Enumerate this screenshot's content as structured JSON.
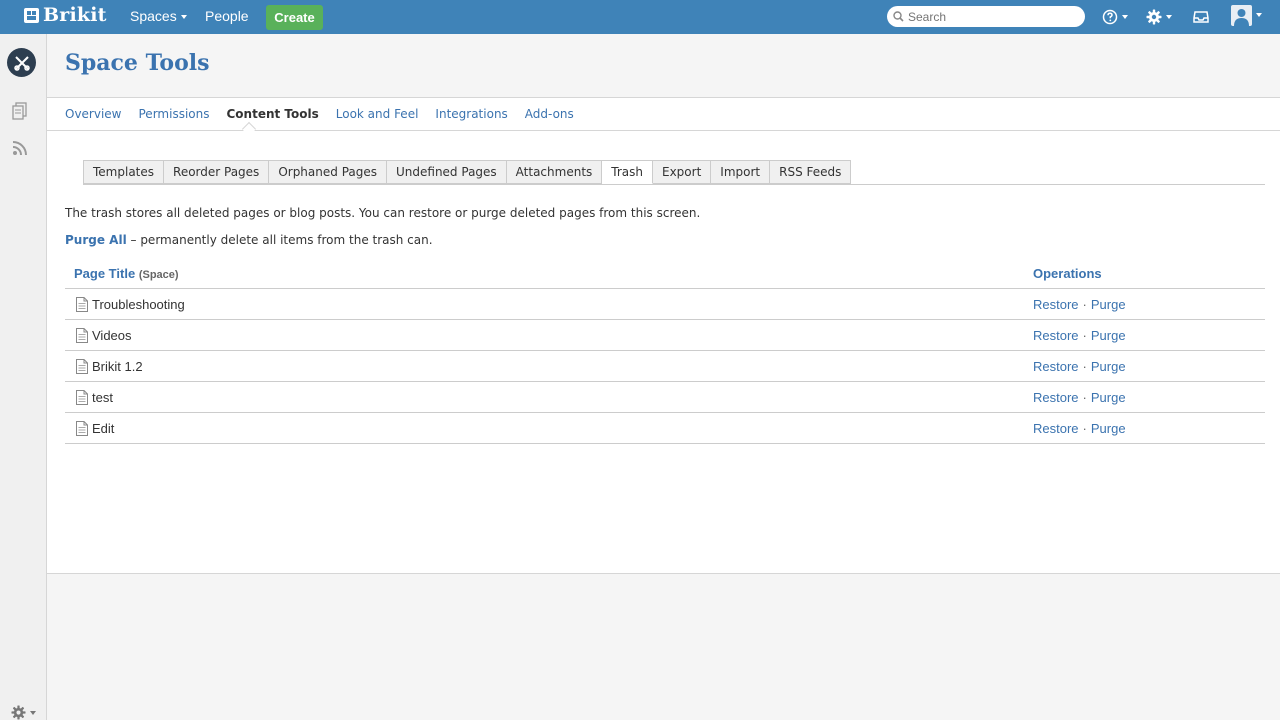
{
  "app": {
    "logo_text": "Brikit",
    "nav": {
      "spaces_label": "Spaces",
      "people_label": "People",
      "create_label": "Create"
    },
    "search": {
      "placeholder": "Search"
    }
  },
  "header": {
    "title": "Space Tools"
  },
  "tabs": [
    {
      "label": "Overview"
    },
    {
      "label": "Permissions"
    },
    {
      "label": "Content Tools"
    },
    {
      "label": "Look and Feel"
    },
    {
      "label": "Integrations"
    },
    {
      "label": "Add-ons"
    }
  ],
  "subtabs": [
    {
      "label": "Templates"
    },
    {
      "label": "Reorder Pages"
    },
    {
      "label": "Orphaned Pages"
    },
    {
      "label": "Undefined Pages"
    },
    {
      "label": "Attachments"
    },
    {
      "label": "Trash"
    },
    {
      "label": "Export"
    },
    {
      "label": "Import"
    },
    {
      "label": "RSS Feeds"
    }
  ],
  "trash": {
    "description": "The trash stores all deleted pages or blog posts. You can restore or purge deleted pages from this screen.",
    "purge_all_label": "Purge All",
    "purge_all_desc": " – permanently delete all items from the trash can.",
    "col_title": "Page Title",
    "col_space": "(Space)",
    "col_ops": "Operations",
    "restore_label": "Restore",
    "purge_label": "Purge",
    "separator": "·",
    "rows": [
      {
        "title": "Troubleshooting"
      },
      {
        "title": "Videos"
      },
      {
        "title": "Brikit 1.2"
      },
      {
        "title": "test"
      },
      {
        "title": "Edit"
      }
    ]
  }
}
